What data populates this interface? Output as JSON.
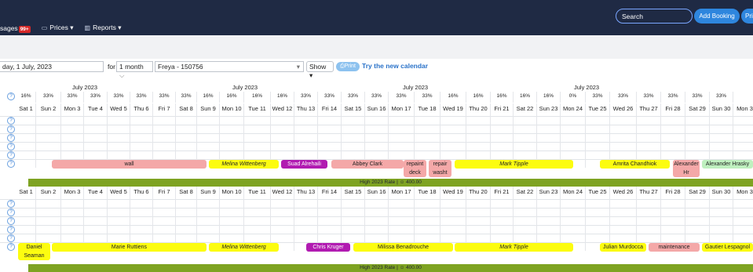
{
  "nav": {
    "messages_label": "sages",
    "messages_badge": "99+",
    "prices_label": "Prices ▾",
    "reports_label": "Reports ▾",
    "prices_icon": "price-tag-icon",
    "reports_icon": "bar-chart-icon"
  },
  "header": {
    "search_placeholder": "Search",
    "add_booking_label": "Add Booking",
    "print_partial_label": "Pri"
  },
  "controls": {
    "date_value": "day, 1 July, 2023",
    "for_label": "for",
    "period_value": "1 month",
    "property_value": "Freya - 150756",
    "show_label": "Show ▾",
    "print_label": "Print",
    "try_new_calendar": "Try the new calendar"
  },
  "calendar": {
    "month_label": "July 2023",
    "occupancy": [
      "16%",
      "33%",
      "33%",
      "33%",
      "33%",
      "33%",
      "33%",
      "33%",
      "16%",
      "16%",
      "16%",
      "16%",
      "33%",
      "33%",
      "33%",
      "33%",
      "33%",
      "33%",
      "16%",
      "16%",
      "16%",
      "16%",
      "16%",
      "0%",
      "33%",
      "33%",
      "33%",
      "33%",
      "33%",
      "33%"
    ],
    "days": [
      "Sat 1",
      "Sun 2",
      "Mon 3",
      "Tue 4",
      "Wed 5",
      "Thu 6",
      "Fri 7",
      "Sat 8",
      "Sun 9",
      "Mon 10",
      "Tue 11",
      "Wed 12",
      "Thu 13",
      "Fri 14",
      "Sat 15",
      "Sun 16",
      "Mon 17",
      "Tue 18",
      "Wed 19",
      "Thu 20",
      "Fri 21",
      "Sat 22",
      "Sun 23",
      "Mon 24",
      "Tue 25",
      "Wed 26",
      "Thu 27",
      "Fri 28",
      "Sat 29",
      "Sun 30",
      "Mon 3"
    ],
    "help_icon": "question-icon",
    "rate_band_1": "High 2023 Rate | ☺ 400.00",
    "rate_band_2": "High 2023 Rate | ☺ 400.00",
    "bookings_room1": [
      {
        "label": "wall",
        "color": "#f4a8a8"
      },
      {
        "label": "Melina Wittenberg",
        "color": "#fcfc10"
      },
      {
        "label": "Suad Alrehaili",
        "color": "#b11bb1"
      },
      {
        "label": "Abbey Clark",
        "color": "#f4a8a8"
      },
      {
        "label": "repaint deck",
        "color": "#f4a8a8"
      },
      {
        "label": "repair washt",
        "color": "#f4a8a8"
      },
      {
        "label": "Mark Tipple",
        "color": "#fcfc10"
      },
      {
        "label": "Amrita Chandhiok",
        "color": "#fcfc10"
      },
      {
        "label": "Alexander Hr",
        "color": "#f4a8a8"
      },
      {
        "label": "Alexander Hrasky",
        "color": "#bff0bf"
      }
    ],
    "bookings_room2": [
      {
        "label": "Daniel Seaman",
        "color": "#fcfc10"
      },
      {
        "label": "Marie Ruttiens",
        "color": "#fcfc10"
      },
      {
        "label": "Melina Wittenberg",
        "color": "#fcfc10"
      },
      {
        "label": "Chris Kruger",
        "color": "#b11bb1"
      },
      {
        "label": "Milissa Benadrouche",
        "color": "#fcfc10"
      },
      {
        "label": "Mark Tipple",
        "color": "#fcfc10"
      },
      {
        "label": "Julian Murdocca",
        "color": "#fcfc10"
      },
      {
        "label": "maintenance",
        "color": "#f4a8a8"
      },
      {
        "label": "Gautier Lespagnol",
        "color": "#fcfc10"
      }
    ]
  }
}
